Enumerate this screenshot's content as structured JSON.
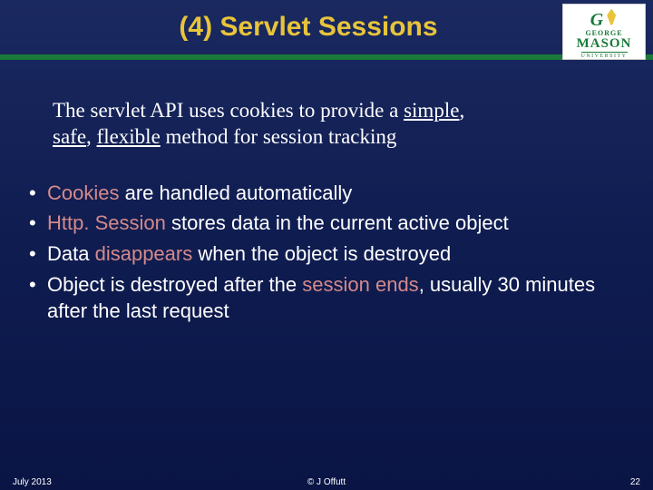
{
  "title": "(4) Servlet Sessions",
  "logo": {
    "george": "GEORGE",
    "mason": "MASON",
    "univ": "UNIVERSITY"
  },
  "intro": {
    "p1a": "The servlet API uses cookies to provide a ",
    "p1b": "simple",
    "p1c": ", ",
    "p2a": "safe",
    "p2b": ", ",
    "p2c": "flexible",
    "p2d": " method for session tracking"
  },
  "bullets": {
    "b1a": "Cookies",
    "b1b": " are handled automatically",
    "b2a": "Http. Session",
    "b2b": " stores data in the current active object",
    "b3a": "Data ",
    "b3b": "disappears",
    "b3c": " when the object is destroyed",
    "b4a": "Object is destroyed after the ",
    "b4b": "session ends",
    "b4c": ", usually 30 minutes after the last request"
  },
  "footer": {
    "date": "July 2013",
    "copy": "© J  Offutt",
    "page": "22"
  }
}
